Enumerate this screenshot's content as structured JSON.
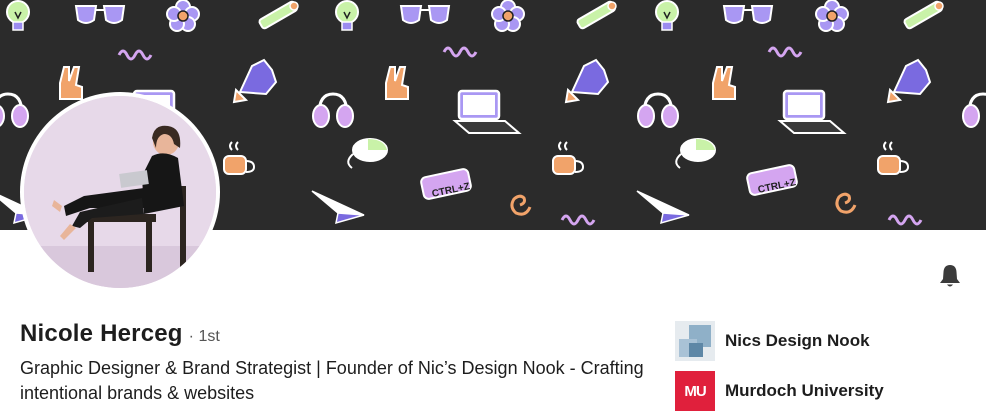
{
  "profile": {
    "name": "Nicole Herceg",
    "degree": "· 1st",
    "headline": "Graphic Designer & Brand Strategist | Founder of Nic’s Design Nook - Crafting intentional brands & websites"
  },
  "organizations": [
    {
      "name": "Nics Design Nook",
      "logo": "nics-design-nook-logo"
    },
    {
      "name": "Murdoch University",
      "logo": "murdoch-university-logo",
      "logo_text": "MU"
    }
  ],
  "banner": {
    "ctrl_z_text": "CTRL+Z",
    "background": "#2b2b2b",
    "accent_purple": "#9c8cf0",
    "accent_orange": "#f1a36a",
    "accent_green": "#c9f2a8"
  },
  "actions": {
    "notify_icon": "bell-icon"
  },
  "colors": {
    "murdoch_red": "#e0203c",
    "text": "#1d1d1d"
  }
}
